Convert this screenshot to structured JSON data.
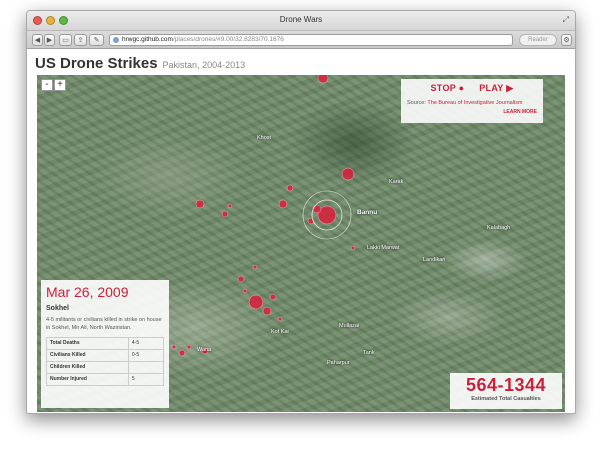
{
  "window": {
    "title": "Drone Wars",
    "url_host": "hrwgc.github.com",
    "url_path": "/places/drones/#9.00/32.8283/70.1676",
    "reader_label": "Reader"
  },
  "header": {
    "title": "US Drone Strikes",
    "subtitle": "Pakistan, 2004-2013"
  },
  "zoom": {
    "out_label": "-",
    "in_label": "+"
  },
  "playback": {
    "stop_label": "STOP ●",
    "play_label": "PLAY ▶",
    "source_prefix": "Source:",
    "source_name": "The Bureau of Investigative Journalism",
    "learn_more_label": "LEARN MORE"
  },
  "strike": {
    "date": "Mar 26, 2009",
    "place": "Sokhel",
    "description": "4-5 militants or civilians killed in strike on house in Sokhel, Mir Ali, North Waziristan.",
    "stats": [
      {
        "label": "Total Deaths",
        "value": "4-5"
      },
      {
        "label": "Civilians Killed",
        "value": "0-5"
      },
      {
        "label": "Children Killed",
        "value": ""
      },
      {
        "label": "Number Injured",
        "value": "5"
      }
    ]
  },
  "total": {
    "range": "564-1344",
    "label": "Estimated Total Casualties"
  },
  "places": [
    {
      "name": "Bannu"
    },
    {
      "name": "Lakki Marwat"
    },
    {
      "name": "Karak"
    },
    {
      "name": "Tank"
    },
    {
      "name": "Mullazai"
    },
    {
      "name": "Paharpur"
    },
    {
      "name": "Kot Kai"
    },
    {
      "name": "Wana"
    },
    {
      "name": "Khost"
    },
    {
      "name": "Landikan"
    },
    {
      "name": "Kalabagh"
    }
  ],
  "colors": {
    "accent": "#cc1f3a",
    "marker": "#dc1e3c"
  }
}
